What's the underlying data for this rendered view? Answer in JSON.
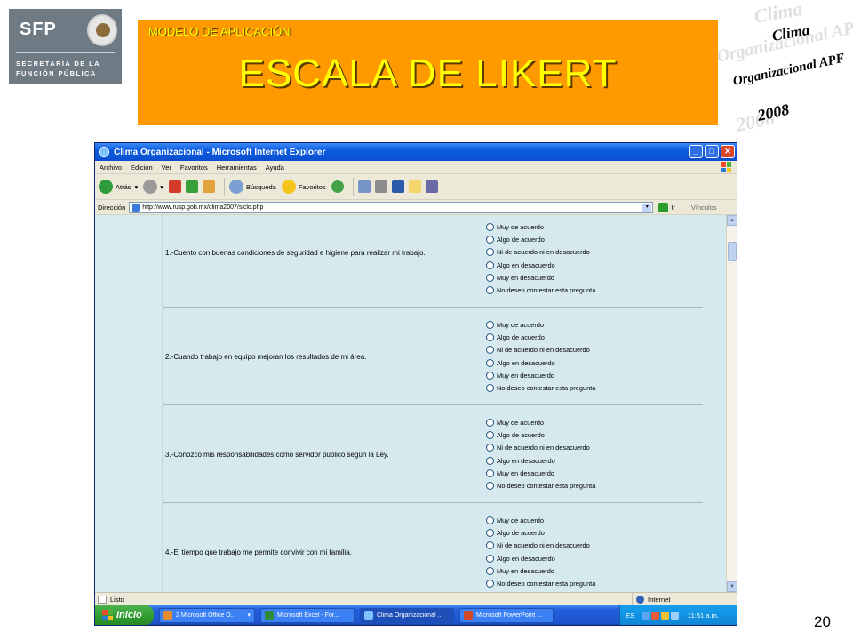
{
  "slide": {
    "eyebrow": "MODELO DE APLICACIÓN",
    "title": "ESCALA DE LIKERT",
    "page_number": "20"
  },
  "sfp_logo": {
    "acronym": "SFP",
    "line1": "SECRETARÍA DE LA",
    "line2": "FUNCIÓN PÚBLICA"
  },
  "clima_logo": {
    "word1": "Clima",
    "word2": "Organizacional APF",
    "year": "2008"
  },
  "browser": {
    "window_title": "Clima Organizacional - Microsoft Internet Explorer",
    "menu": [
      "Archivo",
      "Edición",
      "Ver",
      "Favoritos",
      "Herramientas",
      "Ayuda"
    ],
    "toolbar": {
      "back": "Atrás",
      "search": "Búsqueda",
      "favorites": "Favoritos"
    },
    "address_label": "Dirección",
    "address_value": "http://www.rusp.gob.mx/clima2007/siclo.php",
    "go_label": "Ir",
    "links_label": "Vínculos",
    "status_text": "Listo",
    "zone_text": "Internet"
  },
  "survey": {
    "options": [
      "Muy de acuerdo",
      "Algo de acuerdo",
      "Ni de acuerdo ni en desacuerdo",
      "Algo en desacuerdo",
      "Muy en desacuerdo",
      "No deseo contestar esta pregunta"
    ],
    "questions": [
      "1.-Cuento con buenas condiciones de seguridad e higiene para realizar mi trabajo.",
      "2.-Cuando trabajo en equipo mejoran los resultados de mi área.",
      "3.-Conozco mis responsabilidades como servidor público según la Ley.",
      "4.-El tiempo que trabajo me permite convivir con mi familia."
    ]
  },
  "taskbar": {
    "start_label": "Inicio",
    "tasks": [
      "2 Microsoft Office O...",
      "Microsoft Excel - For...",
      "Clima Organizacional ...",
      "Microsoft PowerPoint ..."
    ],
    "language": "ES",
    "clock": "11:51 a.m."
  }
}
